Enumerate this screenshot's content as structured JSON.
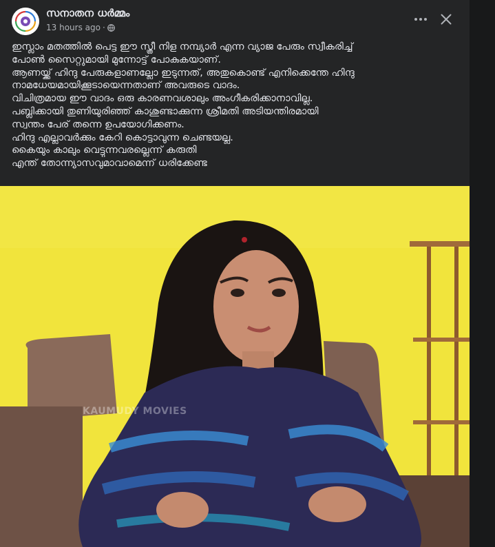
{
  "post": {
    "page_name": "സനാതന ധർമ്മം",
    "timestamp": "13 hours ago",
    "separator": "·",
    "privacy_icon": "globe-icon",
    "more_icon": "more-horizontal-icon",
    "close_icon": "close-icon",
    "text_lines": [
      "ഇസ്ലാം മതത്തിൽ പെട്ട ഈ സ്ത്രീ നിള നമ്പ്യാർ എന്ന വ്യാജ പേരും സ്വീകരിച്ച്",
      "പോൺ സൈറ്റുമായി മുന്നോട്ട് പോകുകയാണ്.",
      "ആണയ്ക്ക് ഹിന്ദു പേരുകളാണല്ലോ ഇടുന്നത്, അതുകൊണ്ട് എനിക്കെന്തേ ഹിന്ദു",
      "നാമധേയമായിക്കൂടായെന്നതാണ് അവരുടെ വാദം.",
      "വിചിത്രമായ ഈ വാദം ഒരു കാരണവശാലും അംഗീകരിക്കാനാവില്ല.",
      "പബ്ലിക്കായി തുണിയുരിഞ്ഞ് കാശുണ്ടാക്കുന്ന ശ്രീമതി അടിയന്തിരമായി",
      "സ്വന്തം പേര് തന്നെ ഉപയോഗിക്കണം.",
      "ഹിന്ദു എല്ലാവർക്കും കേറി കൊട്ടാവുന്ന ചെണ്ടയല്ല.",
      "കൈയും കാലും വെട്ടുന്നവരല്ലെന്ന് കരുതി",
      "എന്ത് തോന്ന്യാസവുമാവാമെന്ന് ധരിക്കേണ്ട"
    ],
    "image": {
      "watermark": "KAUMUDY MOVIES",
      "background_color": "#f2e33a"
    }
  },
  "colors": {
    "surface": "#242526",
    "page_bg": "#18191a",
    "text_primary": "#e4e6eb",
    "text_secondary": "#b0b3b8"
  }
}
